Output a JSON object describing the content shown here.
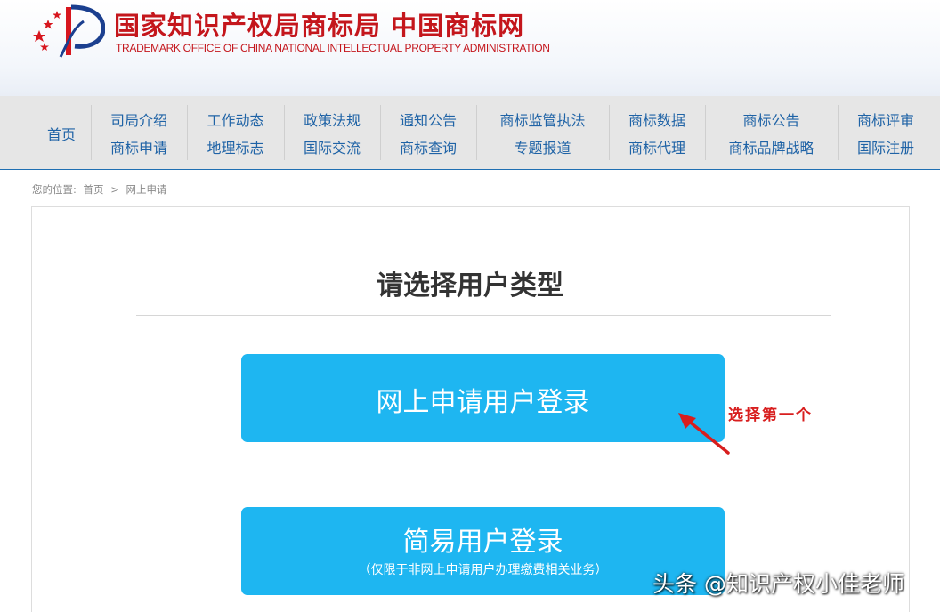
{
  "header": {
    "title": "国家知识产权局商标局 中国商标网",
    "subtitle": "TRADEMARK OFFICE OF CHINA NATIONAL INTELLECTUAL PROPERTY ADMINISTRATION",
    "brand_color": "#c4161c"
  },
  "nav": {
    "home": "首页",
    "columns": [
      {
        "top": "司局介绍",
        "bottom": "商标申请"
      },
      {
        "top": "工作动态",
        "bottom": "地理标志"
      },
      {
        "top": "政策法规",
        "bottom": "国际交流"
      },
      {
        "top": "通知公告",
        "bottom": "商标查询"
      },
      {
        "top": "商标监管执法",
        "bottom": "专题报道"
      },
      {
        "top": "商标数据",
        "bottom": "商标代理"
      },
      {
        "top": "商标公告",
        "bottom": "商标品牌战略"
      },
      {
        "top": "商标评审",
        "bottom": "国际注册"
      }
    ],
    "link_color": "#1f63a6"
  },
  "breadcrumb": {
    "prefix": "您的位置:",
    "home": "首页",
    "sep": ">",
    "current": "网上申请"
  },
  "main": {
    "title": "请选择用户类型",
    "online_button": "网上申请用户登录",
    "simple_button": "简易用户登录",
    "simple_note": "（仅限于非网上申请用户办理缴费相关业务）",
    "button_color": "#1eb6f1"
  },
  "annotation": {
    "text": "选择第一个",
    "color": "#d81e1e",
    "icon": "arrow-icon"
  },
  "watermark": {
    "text": "头条 @知识产权小佳老师"
  }
}
